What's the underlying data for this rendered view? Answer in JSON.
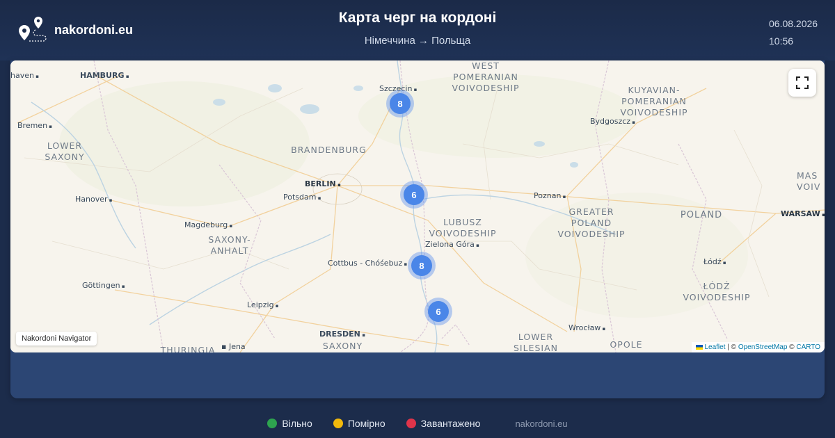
{
  "header": {
    "site": "nakordoni.eu",
    "title": "Карта черг на кордоні",
    "route": "Німеччина → Польща",
    "date": "06.08.2026",
    "time": "10:56"
  },
  "map": {
    "navigator_label": "Nakordoni Navigator",
    "attribution": {
      "leaflet": "Leaflet",
      "sep1": " | © ",
      "osm": "OpenStreetMap",
      "sep2": " © ",
      "carto": "CARTO"
    },
    "clusters": [
      {
        "count": "8"
      },
      {
        "count": "6"
      },
      {
        "count": "8"
      },
      {
        "count": "6"
      }
    ],
    "labels": {
      "haven": "haven",
      "hamburg": "HAMBURG",
      "bremen": "Bremen",
      "szczecin": "Szczecin",
      "west_pom": "WEST\nPOMERANIAN\nVOIVODESHIP",
      "kuyavian": "KUYAVIAN-\nPOMERANIAN\nVOIVODESHIP",
      "bydgoszcz": "Bydgoszcz",
      "lower_saxony": "LOWER\nSAXONY",
      "brandenburg": "BRANDENBURG",
      "berlin": "BERLIN",
      "potsdam": "Potsdam",
      "hanover": "Hanover",
      "poznan": "Poznan",
      "greater_poland": "GREATER\nPOLAND\nVOIVODESHIP",
      "poland": "POLAND",
      "mas": "MAS\nVOIV",
      "warsaw": "WARSAW",
      "lubusz": "LUBUSZ\nVOIVODESHIP",
      "magdeburg": "Magdeburg",
      "saxony_anhalt": "SAXONY-\nANHALT",
      "zielona": "Zielona Góra",
      "cottbus": "Cottbus - Chóśebuz",
      "lodz_city": "Łódź",
      "lodz_voiv": "ŁÓDŹ\nVOIVODESHIP",
      "gottingen": "Göttingen",
      "leipzig": "Leipzig",
      "wroclaw": "Wrocław",
      "dresden": "DRESDEN",
      "saxony": "SAXONY",
      "lower_silesian": "LOWER\nSILESIAN",
      "opole": "OPOLE",
      "thuringia": "THURINGIA",
      "jena": "Jena"
    }
  },
  "legend": [
    {
      "label": "Вільно",
      "color": "#2ea44f"
    },
    {
      "label": "Помірно",
      "color": "#f2b90c"
    },
    {
      "label": "Завантажено",
      "color": "#e0344a"
    }
  ],
  "footer_site": "nakordoni.eu"
}
